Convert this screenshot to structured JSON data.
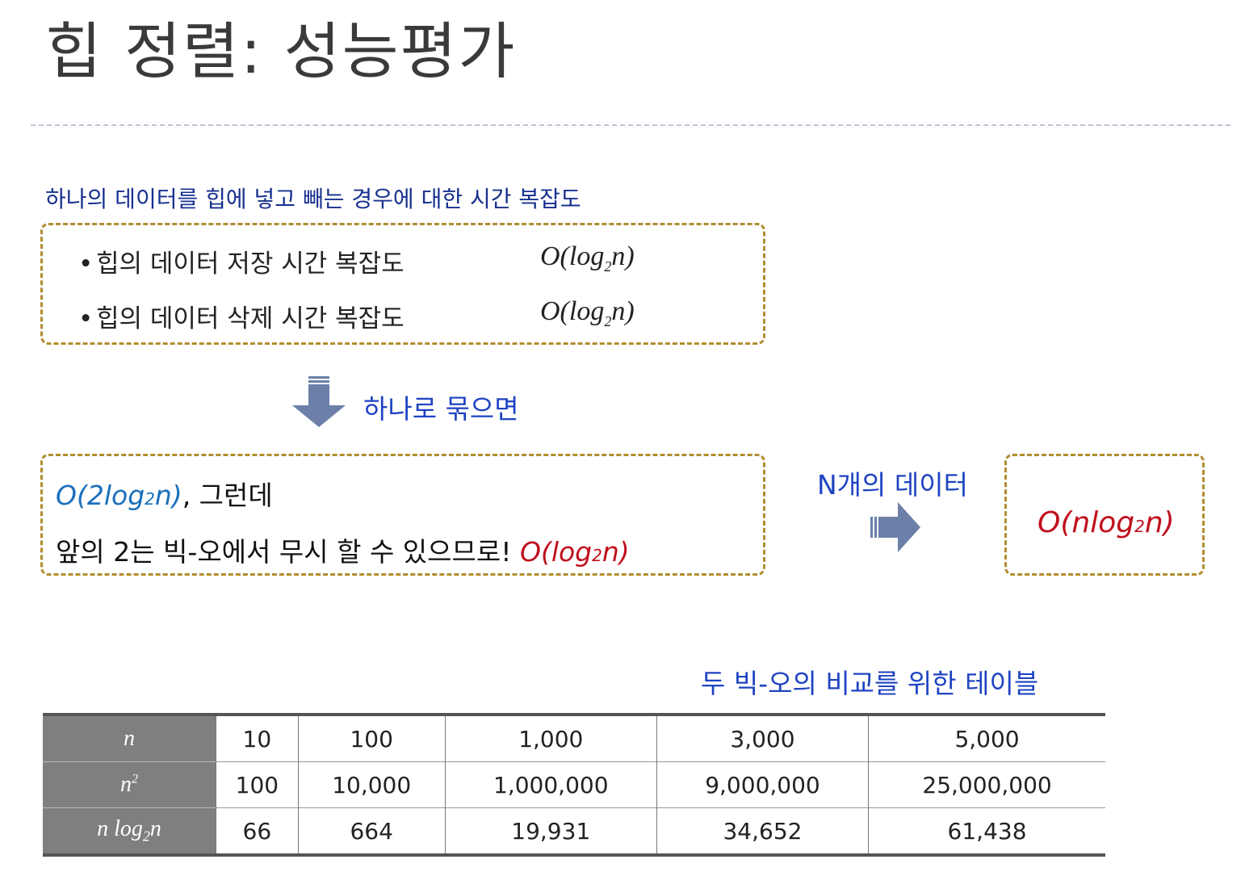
{
  "title": "힙 정렬: 성능평가",
  "caption1": "하나의 데이터를 힙에 넣고 빼는 경우에 대한 시간 복잡도",
  "box1": {
    "rows": [
      {
        "label": "힙의 데이터 저장 시간 복잡도",
        "big_o_prefix": "O(log",
        "big_o_sub": "2",
        "big_o_suffix": "n)"
      },
      {
        "label": "힙의 데이터 삭제 시간 복잡도",
        "big_o_prefix": "O(log",
        "big_o_sub": "2",
        "big_o_suffix": "n)"
      }
    ]
  },
  "combine_label": "하나로 묶으면",
  "box2": {
    "line1_formula_prefix": "O(2log",
    "line1_formula_sub": "2",
    "line1_formula_suffix": "n)",
    "line1_text": ", 그런데",
    "line2_text": "앞의 2는 빅-오에서 무시 할 수 있으므로! ",
    "line2_formula_prefix": "O(log",
    "line2_formula_sub": "2",
    "line2_formula_suffix": "n)"
  },
  "n_data_label": "N개의 데이터",
  "box3": {
    "formula_prefix": "O(nlog",
    "formula_sub": "2",
    "formula_suffix": "n)"
  },
  "table_caption": "두 빅-오의 비교를 위한 테이블",
  "table": {
    "rows": [
      {
        "head": "n",
        "head_sup": "",
        "head_sub": "",
        "head_tail": "",
        "values": [
          "10",
          "100",
          "1,000",
          "3,000",
          "5,000"
        ]
      },
      {
        "head": "n",
        "head_sup": "2",
        "head_sub": "",
        "head_tail": "",
        "values": [
          "100",
          "10,000",
          "1,000,000",
          "9,000,000",
          "25,000,000"
        ]
      },
      {
        "head": "n log",
        "head_sup": "",
        "head_sub": "2",
        "head_tail": "n",
        "values": [
          "66",
          "664",
          "19,931",
          "34,652",
          "61,438"
        ]
      }
    ]
  },
  "colors": {
    "box_border": "#b08d2e",
    "arrow": "#6b7fa8",
    "blue_text": "#1e43c2",
    "red_formula": "#c0101c",
    "header_gray": "#7f7f7f"
  }
}
